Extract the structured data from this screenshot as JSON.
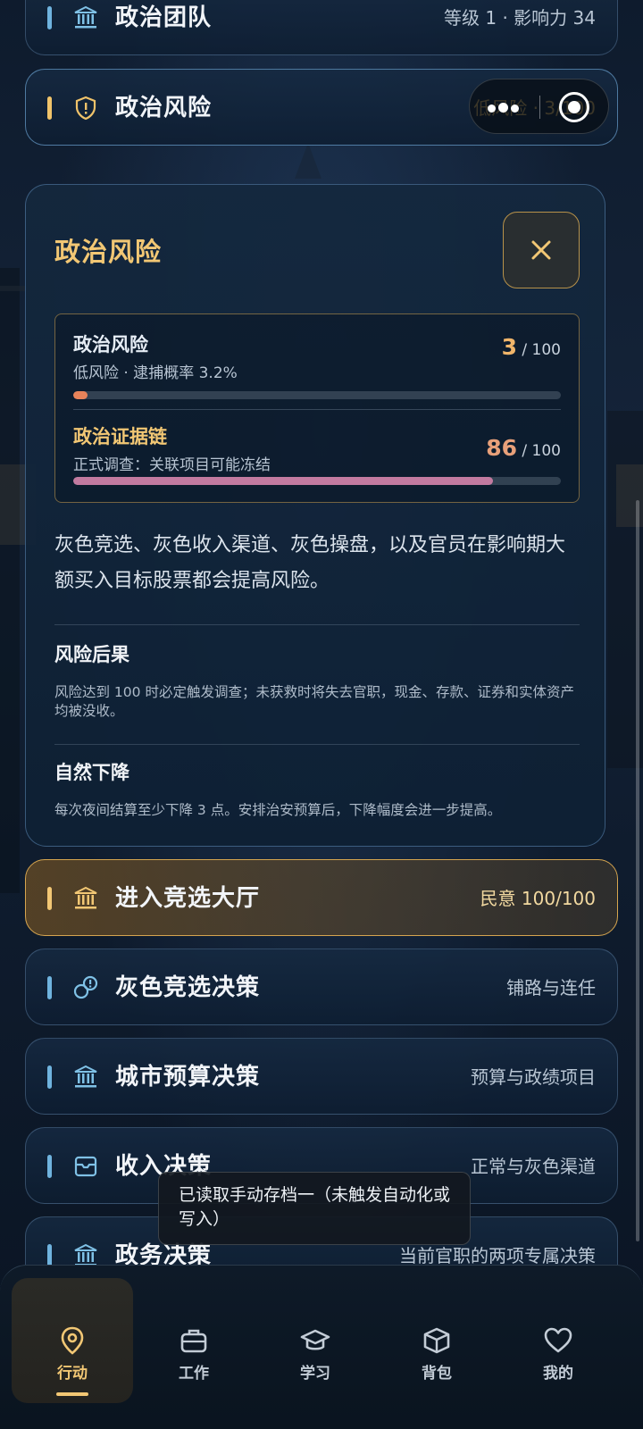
{
  "rows": {
    "team": {
      "title": "政治团队",
      "right": "等级 1 · 影响力 34"
    },
    "risk": {
      "title": "政治风险",
      "right": "低风险 · 3/100"
    },
    "hall": {
      "title": "进入竞选大厅",
      "right": "民意 100/100"
    },
    "gray": {
      "title": "灰色竞选决策",
      "right": "铺路与连任"
    },
    "budget": {
      "title": "城市预算决策",
      "right": "预算与政绩项目"
    },
    "income": {
      "title": "收入决策",
      "right": "正常与灰色渠道"
    },
    "affairs": {
      "title": "政务决策",
      "right": "当前官职的两项专属决策"
    }
  },
  "panel": {
    "title": "政治风险",
    "meters": [
      {
        "name": "政治风险",
        "sub": "低风险 · 逮捕概率 3.2%",
        "value": "3",
        "max": "/ 100",
        "fraction": 0.03,
        "color": "#e8835a"
      },
      {
        "name": "政治证据链",
        "sub": "正式调查：关联项目可能冻结",
        "value": "86",
        "max": "/ 100",
        "fraction": 0.86,
        "color": "#c27aa0"
      }
    ],
    "description": "灰色竞选、灰色收入渠道、灰色操盘，以及官员在影响期大额买入目标股票都会提高风险。",
    "sections": [
      {
        "title": "风险后果",
        "text": "风险达到 100 时必定触发调查；未获救时将失去官职，现金、存款、证券和实体资产均被没收。"
      },
      {
        "title": "自然下降",
        "text": "每次夜间结算至少下降 3 点。安排治安预算后，下降幅度会进一步提高。"
      }
    ]
  },
  "toast": "已读取手动存档一（未触发自动化或写入）",
  "tabs": [
    {
      "label": "行动",
      "icon": "location-pin-icon",
      "active": true
    },
    {
      "label": "工作",
      "icon": "briefcase-icon",
      "active": false
    },
    {
      "label": "学习",
      "icon": "graduation-cap-icon",
      "active": false
    },
    {
      "label": "背包",
      "icon": "package-box-icon",
      "active": false
    },
    {
      "label": "我的",
      "icon": "heart-icon",
      "active": false
    }
  ],
  "colors": {
    "accent_gold": "#f2c774",
    "accent_blue": "#6fb3de",
    "risk_fill": "#e8835a",
    "evidence_fill": "#c27aa0"
  }
}
